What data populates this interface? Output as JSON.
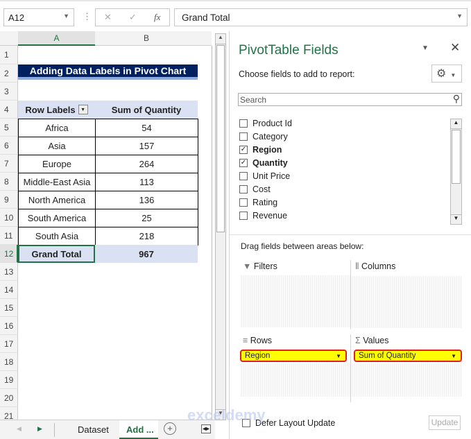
{
  "formula_bar": {
    "name_box": "A12",
    "cancel": "✕",
    "enter": "✓",
    "fx": "fx",
    "value": "Grand Total"
  },
  "columns": [
    "A",
    "B"
  ],
  "rows": [
    "1",
    "2",
    "3",
    "4",
    "5",
    "6",
    "7",
    "8",
    "9",
    "10",
    "11",
    "12",
    "13",
    "14",
    "15",
    "16",
    "17",
    "18",
    "19",
    "20",
    "21"
  ],
  "title": "Adding Data Labels in Pivot Chart",
  "pivot": {
    "header": [
      "Row Labels",
      "Sum of Quantity"
    ],
    "rows": [
      [
        "Africa",
        "54"
      ],
      [
        "Asia",
        "157"
      ],
      [
        "Europe",
        "264"
      ],
      [
        "Middle-East Asia",
        "113"
      ],
      [
        "North America",
        "136"
      ],
      [
        "South America",
        "25"
      ],
      [
        "South Asia",
        "218"
      ]
    ],
    "total": [
      "Grand Total",
      "967"
    ]
  },
  "sheet_tabs": {
    "tabs": [
      "Dataset",
      "Add"
    ],
    "more": "...",
    "active": "Add"
  },
  "panel": {
    "title": "PivotTable Fields",
    "subtitle": "Choose fields to add to report:",
    "search_placeholder": "Search",
    "fields": [
      {
        "label": "Product Id",
        "checked": false
      },
      {
        "label": "Category",
        "checked": false
      },
      {
        "label": "Region",
        "checked": true
      },
      {
        "label": "Quantity",
        "checked": true
      },
      {
        "label": "Unit Price",
        "checked": false
      },
      {
        "label": "Cost",
        "checked": false
      },
      {
        "label": "Rating",
        "checked": false
      },
      {
        "label": "Revenue",
        "checked": false
      }
    ],
    "drag_label": "Drag fields between areas below:",
    "areas": {
      "filters": "Filters",
      "columns": "Columns",
      "rows": "Rows",
      "values": "Values"
    },
    "rows_item": "Region",
    "values_item": "Sum of Quantity",
    "defer": "Defer Layout Update",
    "update": "Update"
  },
  "watermark": "exceldemy"
}
